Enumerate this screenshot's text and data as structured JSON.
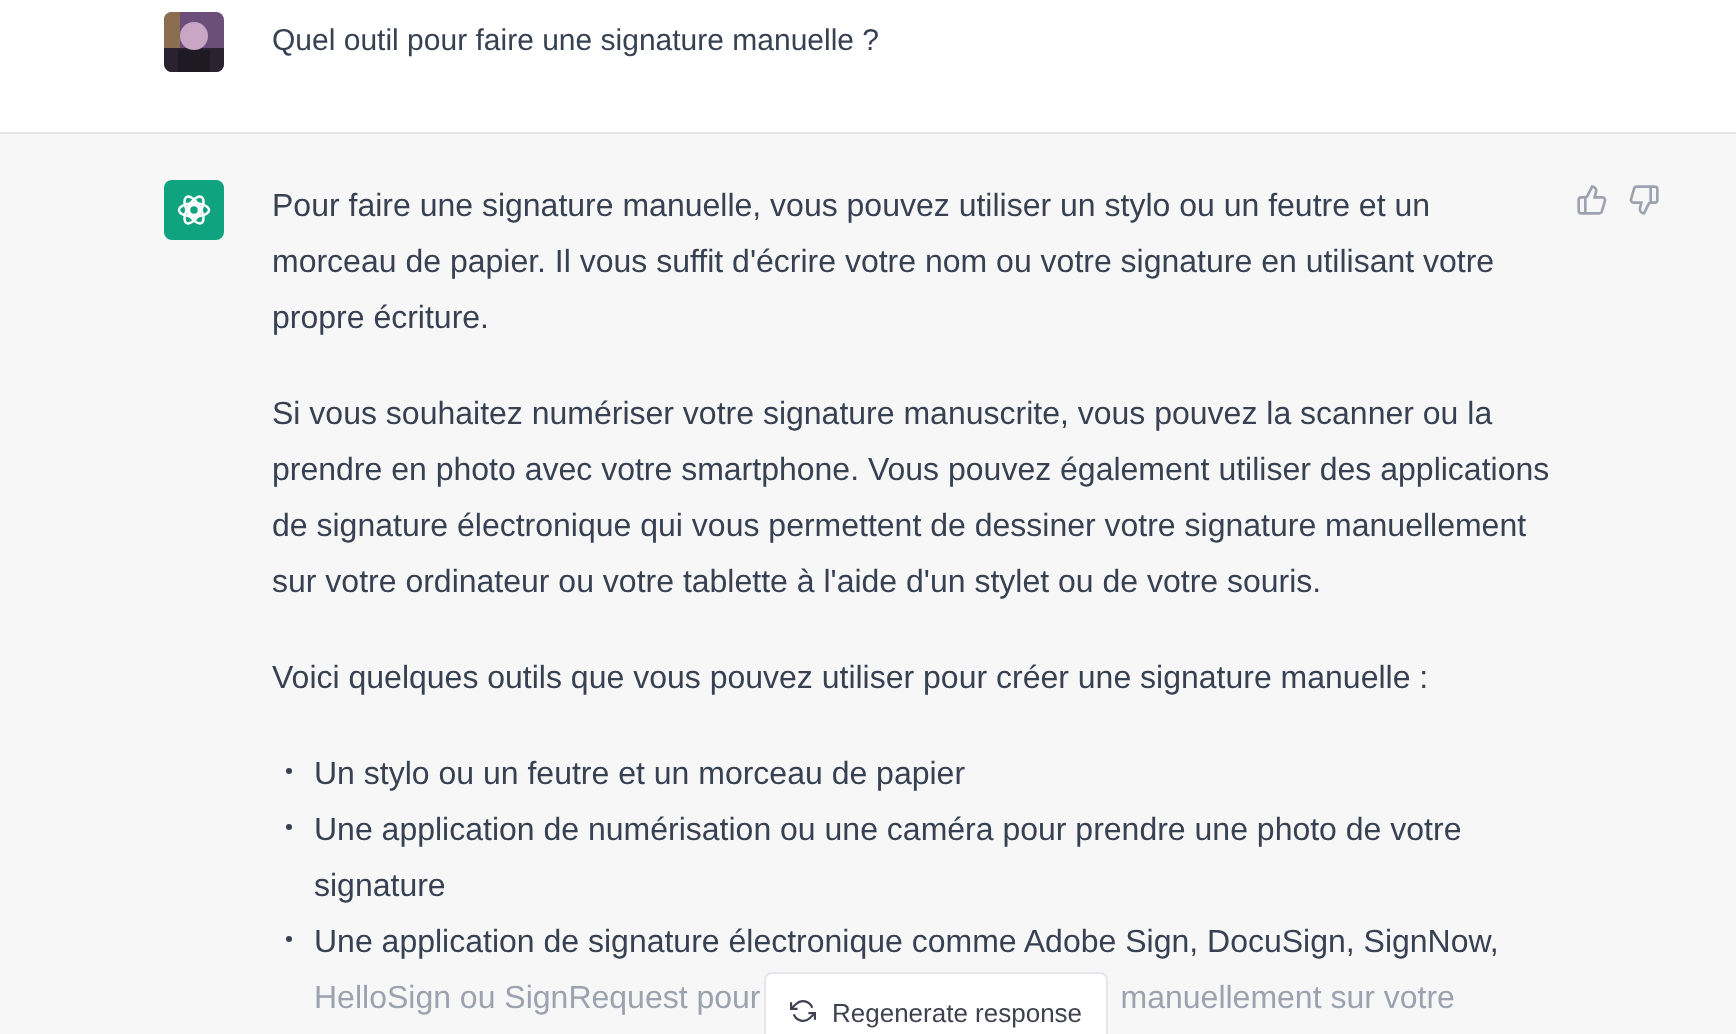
{
  "question": {
    "text": "Quel outil pour faire une signature manuelle ?"
  },
  "answer": {
    "paragraphs": [
      "Pour faire une signature manuelle, vous pouvez utiliser un stylo ou un feutre et un morceau de papier. Il vous suffit d'écrire votre nom ou votre signature en utilisant votre propre écriture.",
      "Si vous souhaitez numériser votre signature manuscrite, vous pouvez la scanner ou la prendre en photo avec votre smartphone. Vous pouvez également utiliser des applications de signature électronique qui vous permettent de dessiner votre signature manuellement sur votre ordinateur ou votre tablette à l'aide d'un stylet ou de votre souris.",
      "Voici quelques outils que vous pouvez utiliser pour créer une signature manuelle :"
    ],
    "bullets": [
      {
        "text": "Un stylo ou un feutre et un morceau de papier"
      },
      {
        "text": "Une application de numérisation ou une caméra pour prendre une photo de votre signature"
      },
      {
        "text": "Une application de signature électronique comme Adobe Sign, DocuSign, SignNow,",
        "covered_line": [
          "HelloSign ou SignRequest pour",
          "manuellement sur votre"
        ]
      }
    ]
  },
  "regenerate_button": {
    "label": "Regenerate response"
  }
}
